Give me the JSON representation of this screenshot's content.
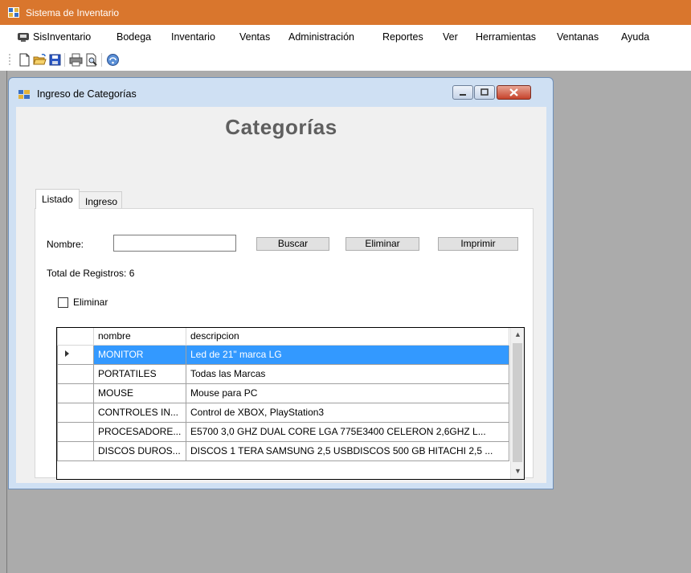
{
  "app": {
    "title": "Sistema de Inventario"
  },
  "menubar": {
    "items": [
      "SisInventario",
      "Bodega",
      "Inventario",
      "Ventas",
      "Administración",
      "Reportes",
      "Ver",
      "Herramientas",
      "Ventanas",
      "Ayuda"
    ]
  },
  "toolbar": {
    "icons": [
      "new-file-icon",
      "open-folder-icon",
      "save-icon",
      "print-icon",
      "print-preview-icon",
      "help-icon"
    ]
  },
  "child_window": {
    "title": "Ingreso de Categorías",
    "heading": "Categorías",
    "tabs": [
      "Listado",
      "Ingreso"
    ],
    "form": {
      "nombre_label": "Nombre:",
      "nombre_value": "",
      "buscar_label": "Buscar",
      "eliminar_label": "Eliminar",
      "imprimir_label": "Imprimir",
      "total_text": "Total de Registros: 6",
      "eliminar_checkbox_label": "Eliminar"
    },
    "grid": {
      "columns": [
        "nombre",
        "descripcion"
      ],
      "selected_row": 0,
      "rows": [
        {
          "nombre": "MONITOR",
          "descripcion": "Led de 21\" marca LG"
        },
        {
          "nombre": "PORTATILES",
          "descripcion": "Todas las Marcas"
        },
        {
          "nombre": "MOUSE",
          "descripcion": "Mouse para PC"
        },
        {
          "nombre": "CONTROLES IN...",
          "descripcion": "Control de XBOX, PlayStation3"
        },
        {
          "nombre": "PROCESADORE...",
          "descripcion": "E5700 3,0 GHZ DUAL CORE LGA  775E3400 CELERON 2,6GHZ L..."
        },
        {
          "nombre": "DISCOS DUROS...",
          "descripcion": "DISCOS 1 TERA SAMSUNG 2,5 USBDISCOS 500 GB HITACHI 2,5 ..."
        }
      ]
    }
  },
  "colors": {
    "titlebar": "#d9762d",
    "selection": "#3399ff",
    "mdi_background": "#ababab"
  }
}
